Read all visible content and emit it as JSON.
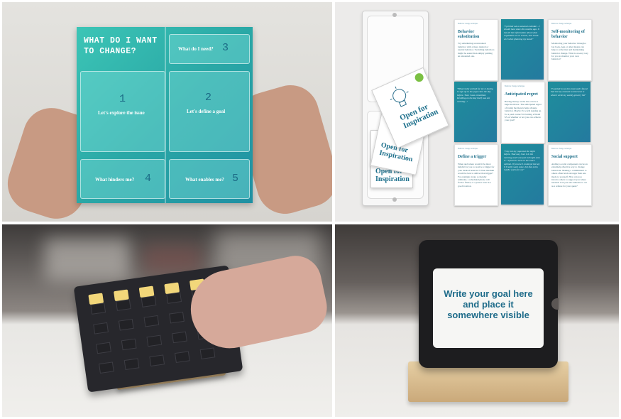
{
  "panels": {
    "worksheet": {
      "title": "WHAT DO I WANT TO CHANGE?",
      "sections": [
        {
          "num": "1",
          "label": "Let's explore the issue"
        },
        {
          "num": "2",
          "label": "Let's define a goal"
        },
        {
          "num": "3",
          "label": "What do I need?"
        },
        {
          "num": "4",
          "label": "What hinders me?"
        },
        {
          "num": "5",
          "label": "What enables me?"
        }
      ],
      "colors": {
        "booklet": "#2aa8a6",
        "number": "#1c6b86"
      }
    },
    "cards": {
      "case_cards": [
        "Open for Inspiration",
        "Open for Inspiration",
        "Open for Inspiration"
      ],
      "grid": [
        {
          "kicker": "Behavior change technique",
          "title": "Behavior substitution",
          "body": "Try substituting an unwanted behavior with a more desired or neutral behavior. Switching behaviors might be easier than simply quitting an unwanted one.",
          "style": "white"
        },
        {
          "kicker": "",
          "title": "",
          "body": "\"I printed out a seasonal calendar - I should have done this months ago. It has all the information about what vegetables are in season, and I look at it when planning my meals\"",
          "style": "teal"
        },
        {
          "kicker": "Behavior change technique",
          "title": "Self-monitoring of behavior",
          "body": "Monitoring your behavior through a log book, App or other means can help to reflection and maintaining behavior change. What is an easy way for you to monitor your own behavior?",
          "style": "white"
        },
        {
          "kicker": "",
          "title": "",
          "body": "\"What really worked for me is having to sign up to the yoga class the day before. Then I was committed. Deciding on the day itself was not working...\"",
          "style": "teal"
        },
        {
          "kicker": "Behavior change technique",
          "title": "Anticipated regret",
          "body": "Having money on the line can be a huge motivator. The anticipated regret of losing the money helps change behavior. Maybe it's worth signing up for a paid course? Or betting a friend $5 on whether or not you can achieve your goal?",
          "style": "white"
        },
        {
          "kicker": "",
          "title": "",
          "body": "\"I wanted to eat less meat and I found that the key moment to intervene is when I write my weekly grocery list\"",
          "style": "teal"
        },
        {
          "kicker": "Behavior change technique",
          "title": "Define a trigger",
          "body": "When and where would it be most helpful for you to receive a trigger for your desired behavior? What medium would be best to deliver that trigger? For example create a calendar reminder, a scheduled phone call from a friend, or a post-it note in a good location.",
          "style": "white"
        },
        {
          "kicker": "",
          "title": "",
          "body": "\"I lay out my yoga mat the night before. That way I see it in the morning and I can just roll right onto it\" \"I placed a lock on the snack cabinet. Of course I could get the key if I really want some, but that extra hurdle works for me\"",
          "style": "teal"
        },
        {
          "kicker": "Behavior change technique",
          "title": "Social support",
          "body": "Adding a social component can be an extremely effective way to change behaviour. Making a commitment to others often holds stronger than one made to yourself. How can you involve others to support you where needed? Can you ask someone to act as a referee for your quest?",
          "style": "white"
        }
      ],
      "colors": {
        "teal": "#1e8e9c",
        "heading": "#1e6f8a"
      }
    },
    "tab_board": {
      "tabs_raised": 5,
      "rows": 4,
      "cols": 5,
      "colors": {
        "board": "#27272c",
        "tab": "#f2d77a",
        "stand": "#d8bb8a"
      }
    },
    "frame": {
      "text": "Write your goal here and place it somewhere visible",
      "colors": {
        "frame": "#1d1d1f",
        "text": "#1f6c8a",
        "stand": "#d8bb8a"
      }
    }
  }
}
